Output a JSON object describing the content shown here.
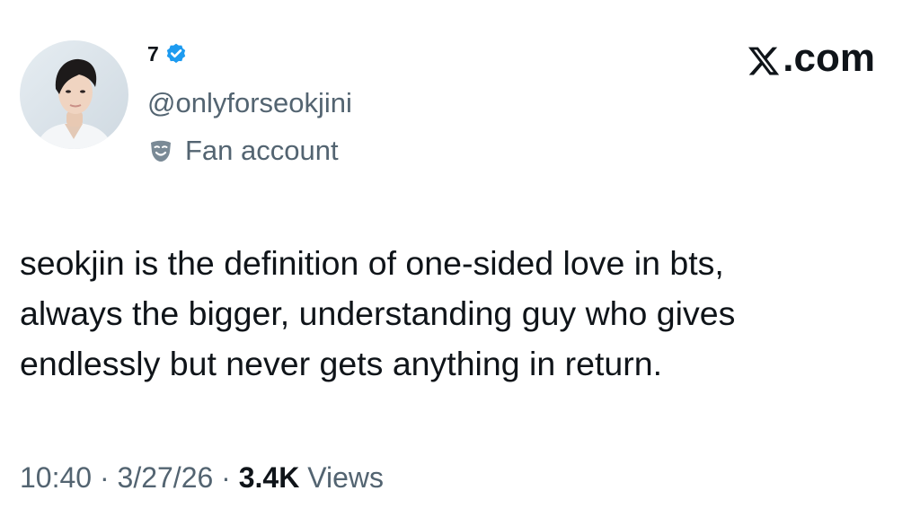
{
  "author": {
    "display_name": "7",
    "handle": "@onlyforseokjini",
    "verified": true,
    "label": "Fan account",
    "label_icon": "theater-masks-icon",
    "avatar": "profile-photo"
  },
  "brand": {
    "logo_icon": "x-logo-icon",
    "suffix": ".com"
  },
  "tweet": {
    "text": "seokjin is the definition of one-sided love in bts,\nalways the bigger, understanding guy who gives\nendlessly but never gets anything in return."
  },
  "meta": {
    "time": "10:40",
    "date": "3/27/26",
    "views_count": "3.4K",
    "views_label": "Views",
    "separator": "·"
  },
  "colors": {
    "text_primary": "#0f1419",
    "text_secondary": "#536471",
    "verified_blue": "#1d9bf0",
    "background": "#ffffff"
  }
}
